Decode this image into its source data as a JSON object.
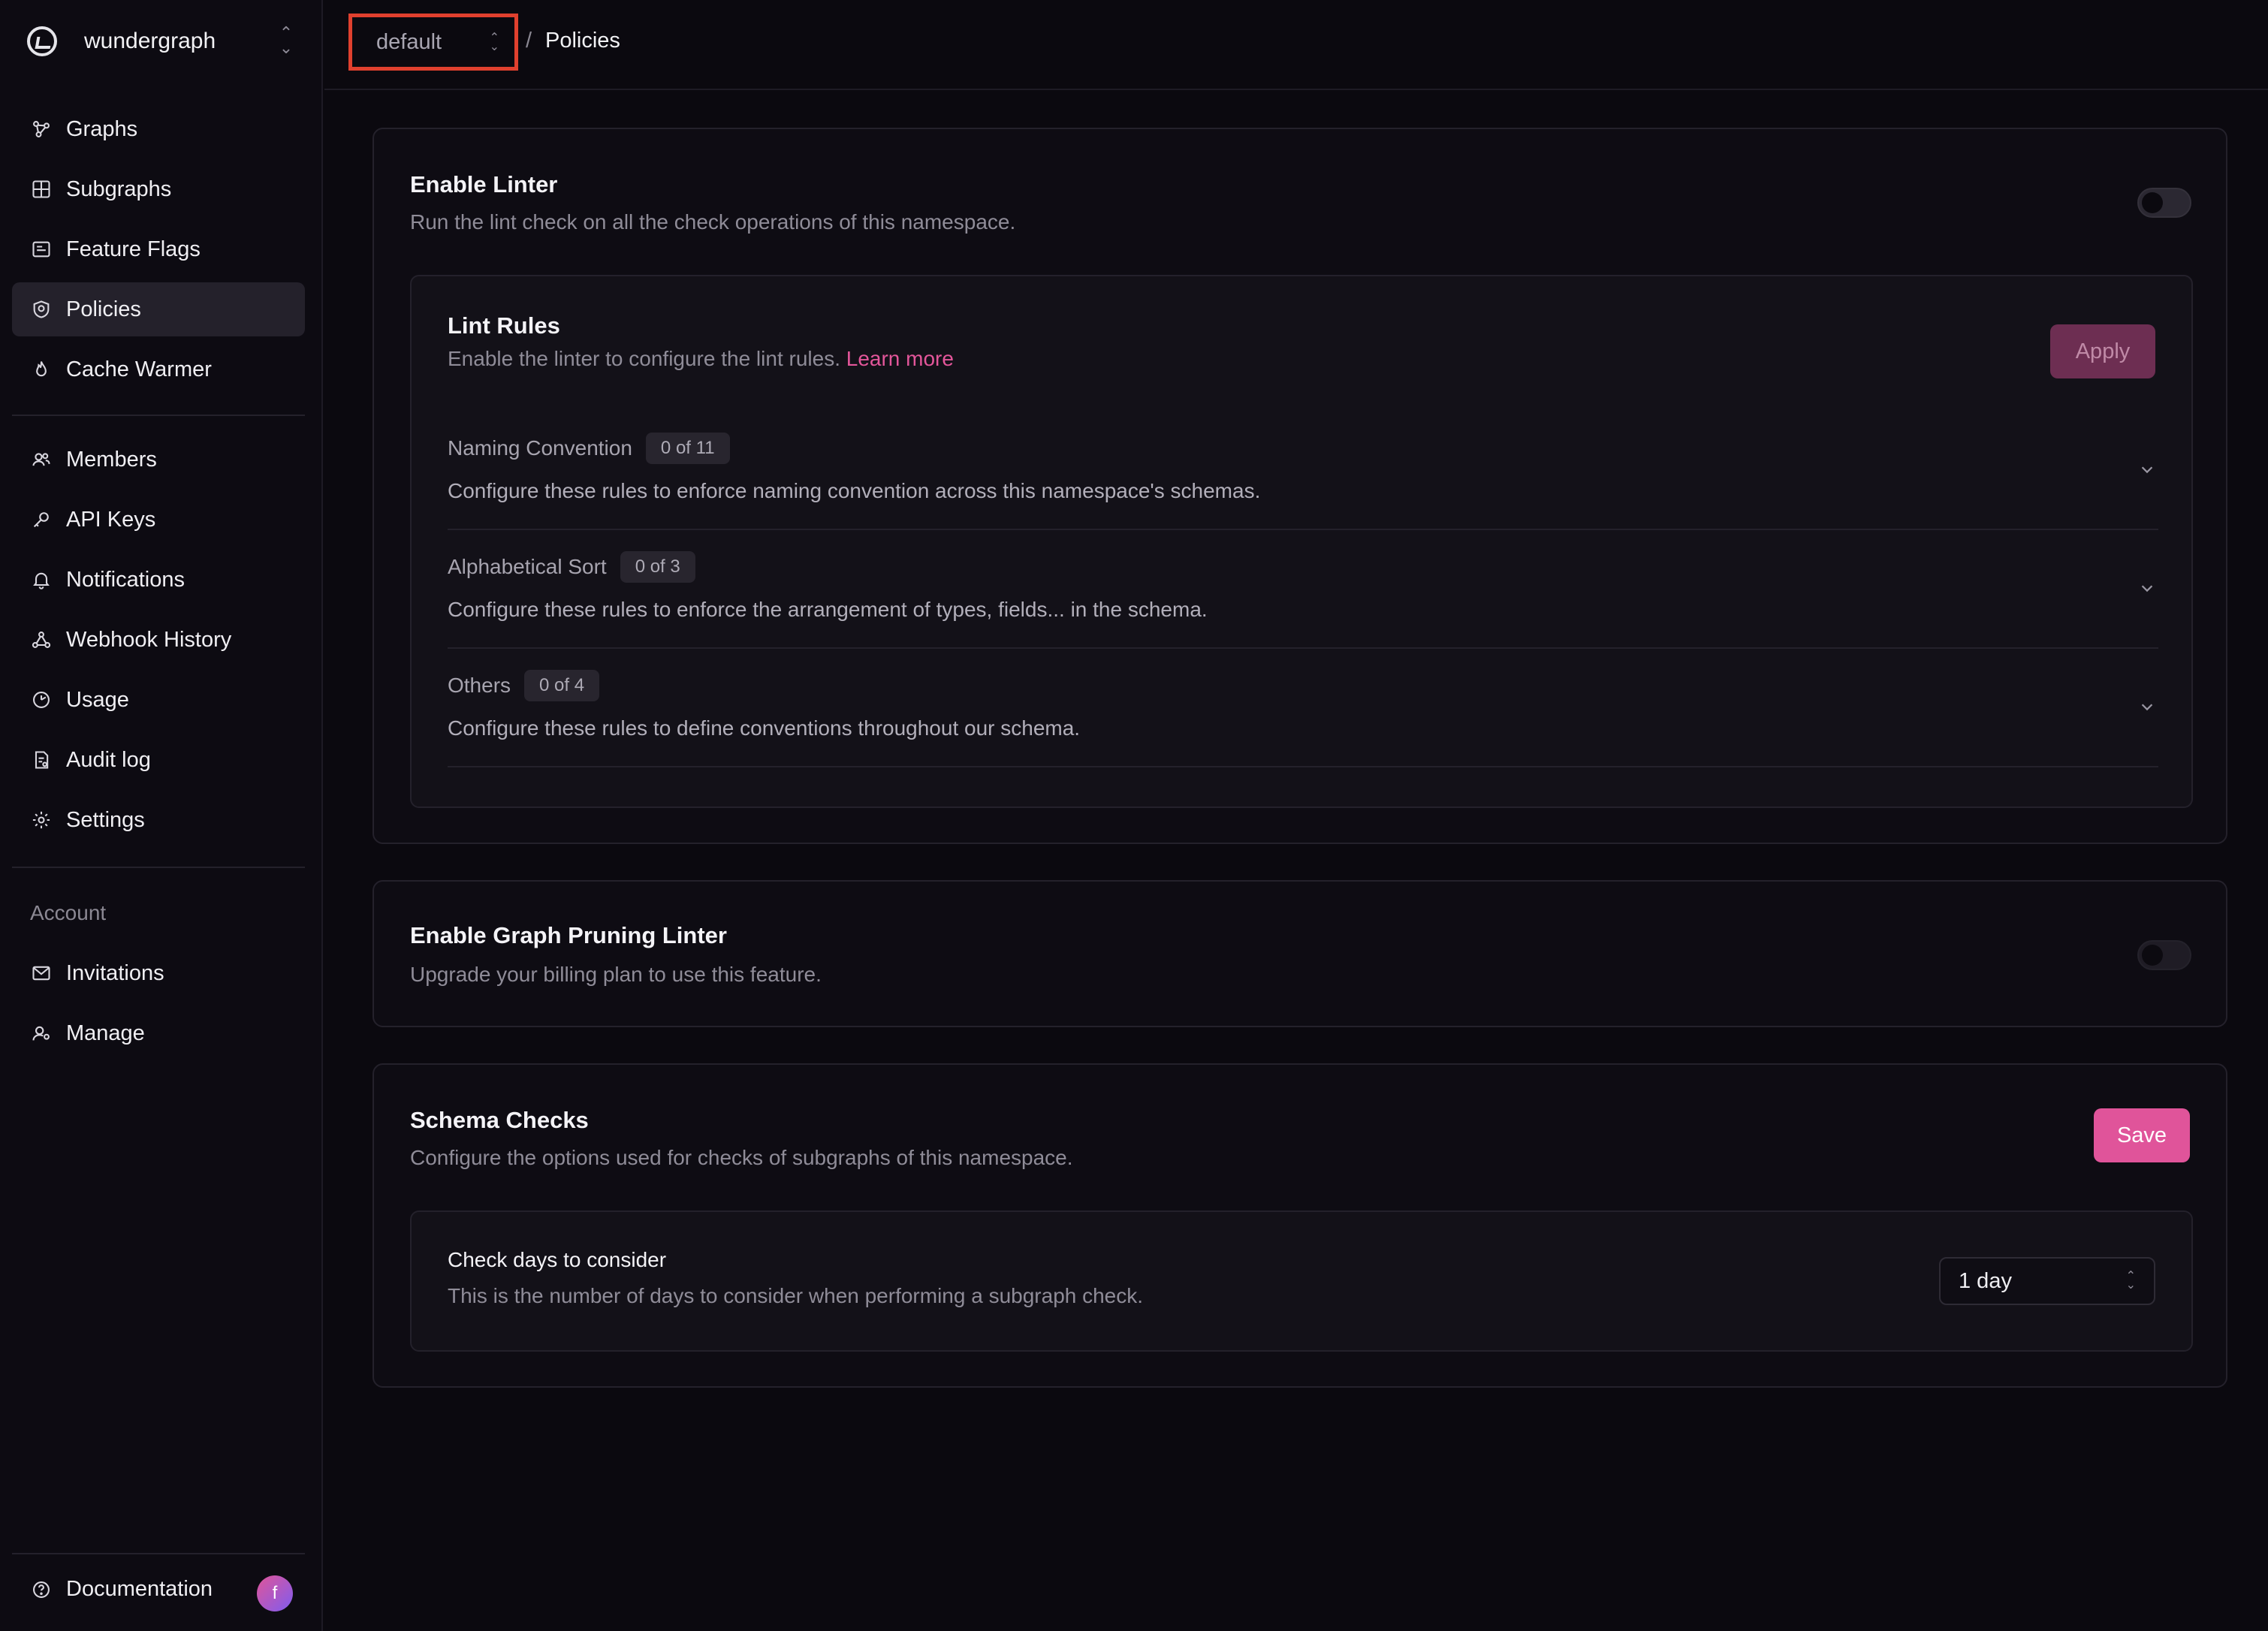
{
  "org": {
    "name": "wundergraph"
  },
  "nav": {
    "main": [
      {
        "label": "Graphs",
        "icon": "graph-icon"
      },
      {
        "label": "Subgraphs",
        "icon": "grid-icon"
      },
      {
        "label": "Feature Flags",
        "icon": "flag-card-icon"
      },
      {
        "label": "Policies",
        "icon": "shield-icon",
        "active": true
      },
      {
        "label": "Cache Warmer",
        "icon": "flame-icon"
      }
    ],
    "secondary": [
      {
        "label": "Members",
        "icon": "members-icon"
      },
      {
        "label": "API Keys",
        "icon": "key-icon"
      },
      {
        "label": "Notifications",
        "icon": "bell-icon"
      },
      {
        "label": "Webhook History",
        "icon": "webhook-icon"
      },
      {
        "label": "Usage",
        "icon": "usage-icon"
      },
      {
        "label": "Audit log",
        "icon": "audit-icon"
      },
      {
        "label": "Settings",
        "icon": "gear-icon"
      }
    ],
    "account_label": "Account",
    "account": [
      {
        "label": "Invitations",
        "icon": "mail-icon"
      },
      {
        "label": "Manage",
        "icon": "user-manage-icon"
      }
    ],
    "documentation": "Documentation",
    "avatar_initial": "f"
  },
  "header": {
    "namespace": "default",
    "separator": "/",
    "current": "Policies"
  },
  "linter": {
    "title": "Enable Linter",
    "description": "Run the lint check on all the check operations of this namespace.",
    "enabled": false,
    "rules": {
      "title": "Lint Rules",
      "description": "Enable the linter to configure the lint rules.",
      "learn_more": "Learn more",
      "apply_label": "Apply",
      "groups": [
        {
          "name": "Naming Convention",
          "count": "0 of 11",
          "description": "Configure these rules to enforce naming convention across this namespace's schemas."
        },
        {
          "name": "Alphabetical Sort",
          "count": "0 of 3",
          "description": "Configure these rules to enforce the arrangement of types, fields... in the schema."
        },
        {
          "name": "Others",
          "count": "0 of 4",
          "description": "Configure these rules to define conventions throughout our schema."
        }
      ]
    }
  },
  "pruning": {
    "title": "Enable Graph Pruning Linter",
    "description": "Upgrade your billing plan to use this feature.",
    "enabled": false
  },
  "schema_checks": {
    "title": "Schema Checks",
    "description": "Configure the options used for checks of subgraphs of this namespace.",
    "save_label": "Save",
    "days": {
      "title": "Check days to consider",
      "description": "This is the number of days to consider when performing a subgraph check.",
      "value": "1 day"
    }
  },
  "colors": {
    "accent": "#e0549a",
    "highlight_border": "#e0402e",
    "background": "#0b090f"
  }
}
